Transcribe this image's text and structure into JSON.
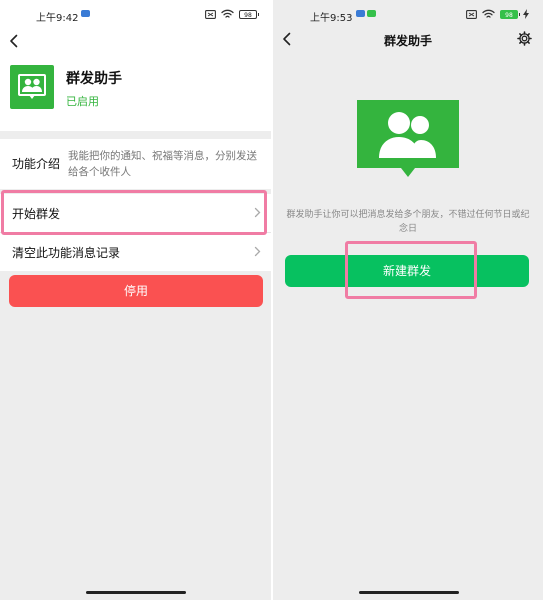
{
  "colors": {
    "brand_green": "#34b43e",
    "primary_button": "#07c160",
    "danger_button": "#fa5151",
    "highlight": "#f07ca4"
  },
  "left": {
    "status": {
      "time": "上午9:42",
      "battery": "98"
    },
    "nav": {
      "back_icon": "chevron-left-icon"
    },
    "app": {
      "icon": "group-broadcast-icon",
      "name": "群发助手",
      "status": "已启用"
    },
    "intro": {
      "label": "功能介绍",
      "text": "我能把你的通知、祝福等消息，分别发送给各个收件人"
    },
    "items": [
      {
        "label": "开始群发"
      },
      {
        "label": "清空此功能消息记录"
      }
    ],
    "disable_button": "停用"
  },
  "right": {
    "status": {
      "time": "上午9:53",
      "battery": "98"
    },
    "nav": {
      "title": "群发助手",
      "back_icon": "chevron-left-icon",
      "settings_icon": "gear-icon"
    },
    "hero_icon": "group-broadcast-icon",
    "description": "群发助手让你可以把消息发给多个朋友，不错过任何节日或纪念日",
    "new_button": "新建群发"
  }
}
